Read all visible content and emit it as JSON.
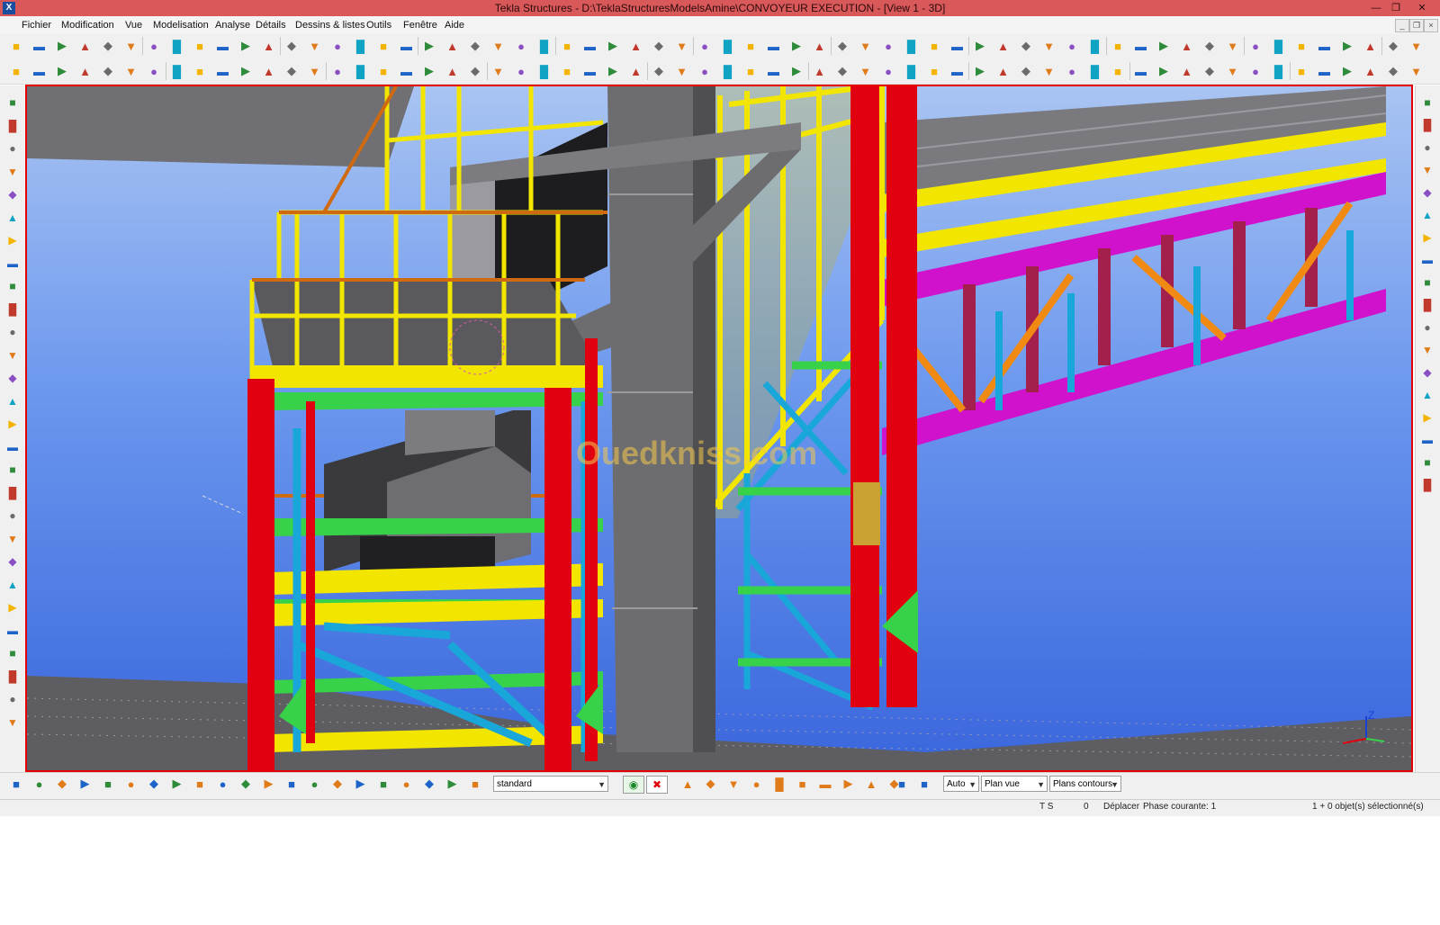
{
  "window": {
    "title": "Tekla Structures - D:\\TeklaStructuresModelsAmine\\CONVOYEUR EXECUTION - [View 1 - 3D]",
    "app_icon": "tekla-icon"
  },
  "menu": {
    "items": [
      "Fichier",
      "Modification",
      "Vue",
      "Modelisation",
      "Analyse",
      "Détails",
      "Dessins & listes",
      "Outils",
      "Fenêtre",
      "Aide"
    ]
  },
  "viewport": {
    "watermark": "Ouedkniss.com",
    "axis_label": "Z",
    "colors": {
      "sky_top": "#a9c4f2",
      "sky_bottom": "#3a66dd",
      "column_red": "#e00010",
      "beam_yellow": "#f2e600",
      "brace_cyan": "#19a6d8",
      "beam_green": "#38d24a",
      "truss_magenta": "#d012cc",
      "brace_orange": "#f08a12",
      "chute_gray": "#6d6d70",
      "floor_gray": "#5e5e62"
    }
  },
  "bottom_toolbar": {
    "selection_filter": "standard",
    "snap_depth": "Auto",
    "plane": "Plan vue",
    "contours": "Plans contours"
  },
  "status": {
    "ts": "T S",
    "count": "0",
    "command": "Déplacer",
    "phase": "Phase courante: 1",
    "selection": "1 + 0 objet(s) sélectionné(s)"
  }
}
